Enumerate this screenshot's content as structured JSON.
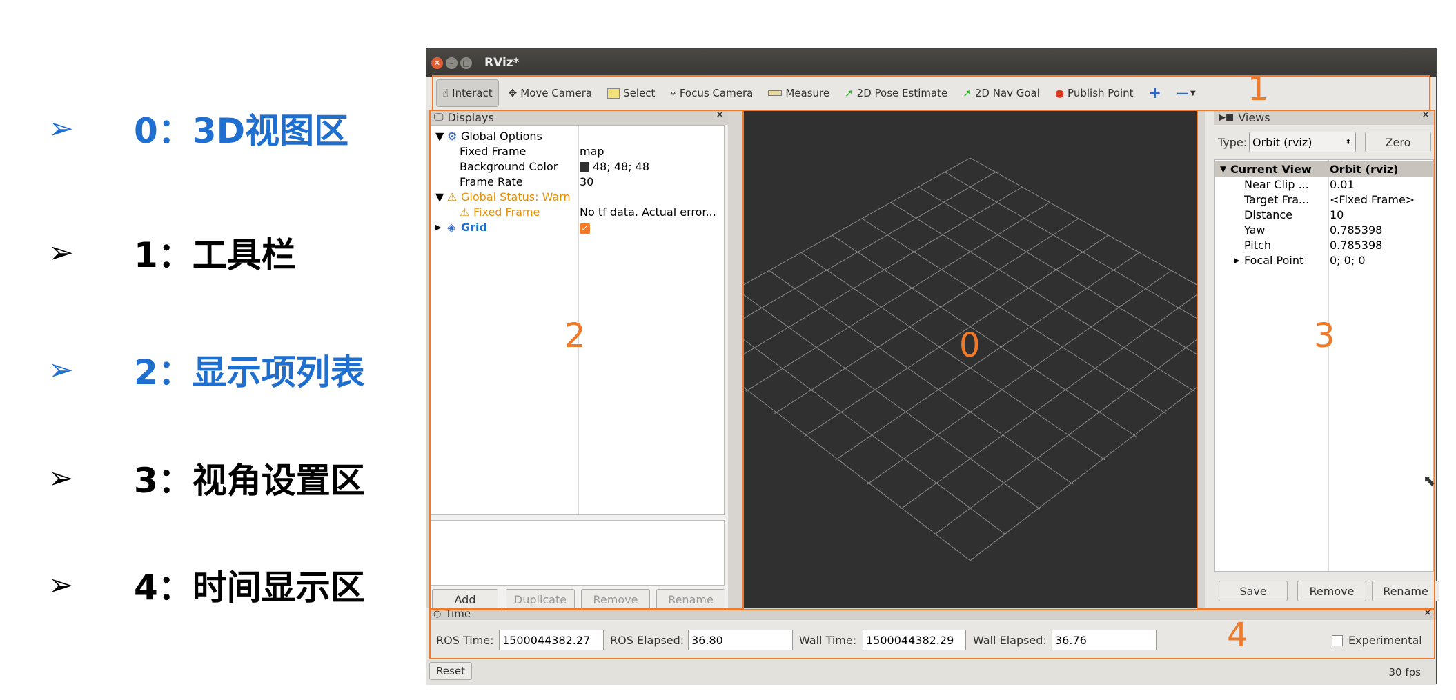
{
  "legend": [
    {
      "marker": "➢",
      "text": "0：3D视图区",
      "color": "#1f6fd1"
    },
    {
      "marker": "➢",
      "text": "1：工具栏",
      "color": "#000000"
    },
    {
      "marker": "➢",
      "text": "2：显示项列表",
      "color": "#1f6fd1"
    },
    {
      "marker": "➢",
      "text": "3：视角设置区",
      "color": "#000000"
    },
    {
      "marker": "➢",
      "text": "4：时间显示区",
      "color": "#000000"
    }
  ],
  "window": {
    "title": "RViz*"
  },
  "toolbar": {
    "tools": [
      {
        "label": "Interact",
        "icon": "hand-icon"
      },
      {
        "label": "Move Camera",
        "icon": "move-camera-icon"
      },
      {
        "label": "Select",
        "icon": "select-icon"
      },
      {
        "label": "Focus Camera",
        "icon": "focus-camera-icon"
      },
      {
        "label": "Measure",
        "icon": "measure-icon"
      },
      {
        "label": "2D Pose Estimate",
        "icon": "pose-arrow-icon"
      },
      {
        "label": "2D Nav Goal",
        "icon": "nav-arrow-icon"
      },
      {
        "label": "Publish Point",
        "icon": "pin-icon"
      }
    ],
    "add_tool": "+",
    "remove_tool": "—"
  },
  "region_numbers": {
    "viewport": "0",
    "toolbar": "1",
    "displays": "2",
    "views": "3",
    "time": "4"
  },
  "displays": {
    "title": "Displays",
    "tree": {
      "global_options": "Global Options",
      "fixed_frame_label": "Fixed Frame",
      "fixed_frame_value": "map",
      "bg_label": "Background Color",
      "bg_value": "48; 48; 48",
      "frame_rate_label": "Frame Rate",
      "frame_rate_value": "30",
      "global_status": "Global Status: Warn",
      "fixed_frame_warn": "Fixed Frame",
      "fixed_frame_warn_value": "No tf data.  Actual error...",
      "grid": "Grid"
    },
    "buttons": {
      "add": "Add",
      "duplicate": "Duplicate",
      "remove": "Remove",
      "rename": "Rename"
    }
  },
  "views": {
    "title": "Views",
    "type_label": "Type:",
    "type_value": "Orbit (rviz)",
    "zero": "Zero",
    "current_view": "Current View",
    "current_view_type": "Orbit (rviz)",
    "props": [
      {
        "k": "Near Clip ...",
        "v": "0.01"
      },
      {
        "k": "Target Fra...",
        "v": "<Fixed Frame>"
      },
      {
        "k": "Distance",
        "v": "10"
      },
      {
        "k": "Yaw",
        "v": "0.785398"
      },
      {
        "k": "Pitch",
        "v": "0.785398"
      },
      {
        "k": "Focal Point",
        "v": "0; 0; 0"
      }
    ],
    "buttons": {
      "save": "Save",
      "remove": "Remove",
      "rename": "Rename"
    }
  },
  "time": {
    "title": "Time",
    "ros_time_label": "ROS Time:",
    "ros_time": "1500044382.27",
    "ros_elapsed_label": "ROS Elapsed:",
    "ros_elapsed": "36.80",
    "wall_time_label": "Wall Time:",
    "wall_time": "1500044382.29",
    "wall_elapsed_label": "Wall Elapsed:",
    "wall_elapsed": "36.76",
    "experimental": "Experimental"
  },
  "status": {
    "reset": "Reset",
    "fps": "30 fps"
  },
  "colors": {
    "accent": "#f07a2a",
    "blue": "#1f6fd1",
    "viewport_bg": "#303030"
  }
}
